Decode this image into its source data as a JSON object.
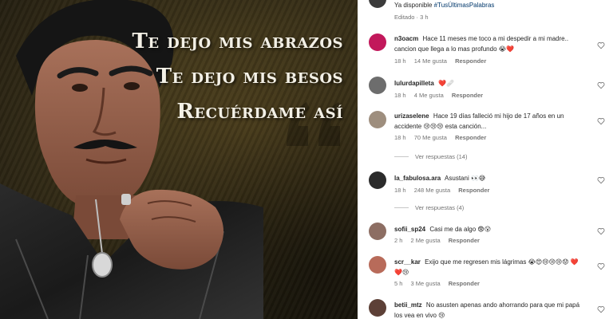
{
  "post": {
    "lyrics": [
      "Te dejo mis abrazos",
      "Te dejo mis besos",
      "Recuérdame así"
    ],
    "caption_prefix": "Ya disponible ",
    "caption_hashtag": "#TusÚltimasPalabras",
    "caption_meta": "Editado · 3 h"
  },
  "comments": [
    {
      "user": "n3oacm",
      "text": "Hace 11 meses me toco a mi despedir a mi madre.. cancion que llega a lo mas profundo",
      "emoji_suffix": "😭❤️",
      "time": "18 h",
      "likes": "14 Me gusta",
      "reply": "Responder",
      "avatar_color": "#c2185b"
    },
    {
      "user": "lulurdapilleta",
      "text": "",
      "emoji_suffix": "❤️🩹",
      "time": "18 h",
      "likes": "4 Me gusta",
      "reply": "Responder",
      "avatar_color": "#6d6d6d"
    },
    {
      "user": "urizaselene",
      "text": "Hace 19 días falleció mi hijo de 17 años en un accidente",
      "text2": "esta canción...",
      "emoji_suffix": "😢😢😢",
      "time": "18 h",
      "likes": "70 Me gusta",
      "reply": "Responder",
      "view_replies": "Ver respuestas (14)",
      "avatar_color": "#9e8e7e"
    },
    {
      "user": "la_fabulosa.ara",
      "text": "Asustani",
      "emoji_suffix": "👀😅",
      "time": "18 h",
      "likes": "248 Me gusta",
      "reply": "Responder",
      "view_replies": "Ver respuestas (4)",
      "avatar_color": "#2b2b2b"
    },
    {
      "user": "sofii_sp24",
      "text": "Casi me da algo",
      "emoji_suffix": "😨😮",
      "time": "2 h",
      "likes": "2 Me gusta",
      "reply": "Responder",
      "avatar_color": "#8d6e63"
    },
    {
      "user": "scr__kar",
      "text": "Exijo que me regresen mis lágrimas",
      "emoji_suffix": "😭😍😢😢😢😟",
      "emoji_line2": "❤️❤️😢",
      "time": "5 h",
      "likes": "3 Me gusta",
      "reply": "Responder",
      "avatar_color": "#b86b5a"
    },
    {
      "user": "betii_mtz",
      "text": "No asusten apenas ando ahorrando para que mi papá los vea en vivo",
      "emoji_suffix": "😢",
      "avatar_color": "#5d4037"
    }
  ],
  "colors": {
    "text": "#262626",
    "meta": "#737373",
    "hashtag": "#00376b",
    "heart_red": "#ed4956",
    "emoji_yellow": "#f7c531"
  },
  "icons": [
    "heart-outline-icon",
    "quote-mark-icon"
  ]
}
